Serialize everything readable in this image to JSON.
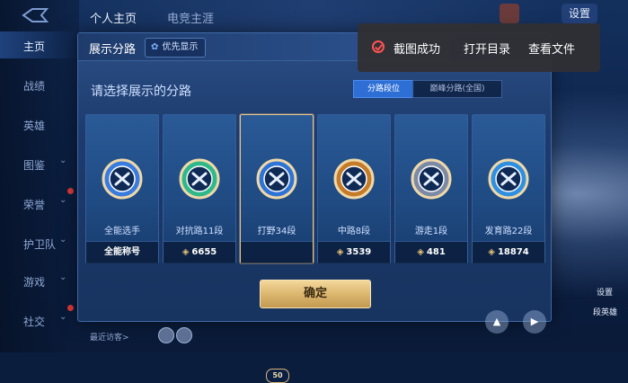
{
  "top_tabs": [
    "个人主页",
    "电竞主涯"
  ],
  "settings_label": "设置",
  "nav": [
    {
      "label": "主页",
      "active": true,
      "chevron": false,
      "dot": false
    },
    {
      "label": "战绩",
      "active": false,
      "chevron": false,
      "dot": false
    },
    {
      "label": "英雄",
      "active": false,
      "chevron": false,
      "dot": false
    },
    {
      "label": "图鉴",
      "active": false,
      "chevron": true,
      "dot": false
    },
    {
      "label": "荣誉",
      "active": false,
      "chevron": true,
      "dot": true
    },
    {
      "label": "护卫队",
      "active": false,
      "chevron": true,
      "dot": false
    },
    {
      "label": "游戏",
      "active": false,
      "chevron": true,
      "dot": false
    },
    {
      "label": "社交",
      "active": false,
      "chevron": true,
      "dot": true
    }
  ],
  "dialog": {
    "title": "展示分路",
    "priority_label": "优先显示",
    "subtitle": "请选择展示的分路",
    "segments": [
      "分路段位",
      "巅峰分路(全国)"
    ],
    "confirm_label": "确定"
  },
  "cards": [
    {
      "name": "全能选手",
      "footer": "全能称号",
      "score": null,
      "selected": false,
      "emblem_color": "#3a7be0"
    },
    {
      "name": "对抗路11段",
      "footer": null,
      "score": "6655",
      "selected": false,
      "emblem_color": "#2fb88a"
    },
    {
      "name": "打野34段",
      "footer": null,
      "score": null,
      "selected": true,
      "badge": "50",
      "emblem_color": "#2e74d6"
    },
    {
      "name": "中路8段",
      "footer": null,
      "score": "3539",
      "selected": false,
      "emblem_color": "#c47b2a"
    },
    {
      "name": "游走1段",
      "footer": null,
      "score": "481",
      "selected": false,
      "emblem_color": "#7d8aa6"
    },
    {
      "name": "发育路22段",
      "footer": null,
      "score": "18874",
      "selected": false,
      "emblem_color": "#2f8fe0"
    }
  ],
  "toast": {
    "status": "截图成功",
    "open_dir": "打开目录",
    "view_file": "查看文件"
  },
  "bottom": {
    "recent_label": "最近访客>",
    "right_labels": [
      "设置",
      "段英雄"
    ]
  }
}
